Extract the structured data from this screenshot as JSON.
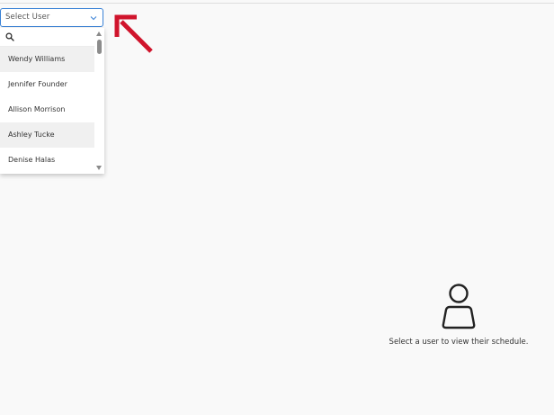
{
  "user_select": {
    "placeholder": "Select User",
    "icon": "chevron-down-icon"
  },
  "dropdown": {
    "search_icon": "search-icon",
    "options": [
      {
        "label": "Wendy Williams",
        "highlighted": true
      },
      {
        "label": "Jennifer Founder",
        "highlighted": false
      },
      {
        "label": "Allison Morrison",
        "highlighted": false
      },
      {
        "label": "Ashley Tucke",
        "highlighted": true
      },
      {
        "label": "Denise Halas",
        "highlighted": false
      }
    ]
  },
  "annotation": {
    "icon": "arrow-up-left-icon",
    "color": "#d0142c"
  },
  "empty_state": {
    "icon": "person-icon",
    "message": "Select a user to view their schedule."
  }
}
